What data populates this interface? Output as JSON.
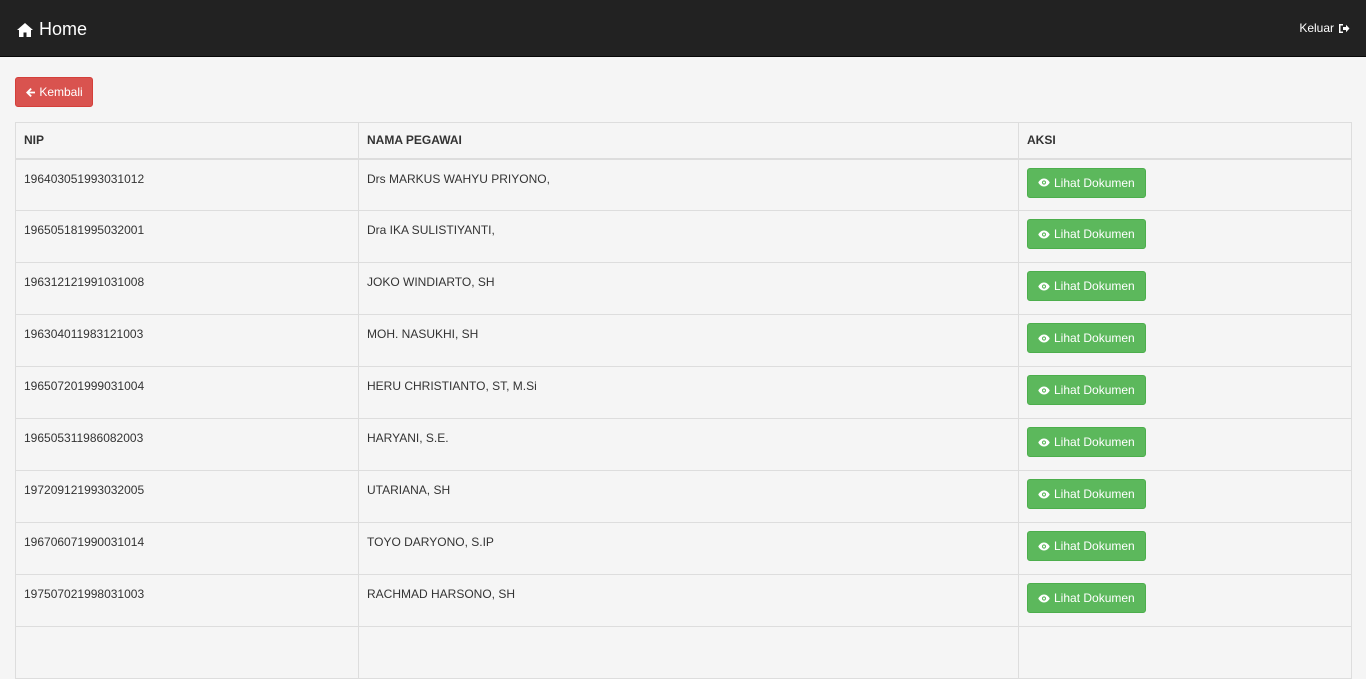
{
  "navbar": {
    "title": "Home",
    "title_icon": "home-icon",
    "logout_label": "Keluar",
    "logout_icon": "sign-out-icon"
  },
  "back_button": {
    "label": "Kembali",
    "icon": "arrow-left-icon"
  },
  "table": {
    "headers": [
      "NIP",
      "NAMA PEGAWAI",
      "AKSI"
    ],
    "action_label": "Lihat Dokumen",
    "action_icon": "eye-icon",
    "rows": [
      {
        "nip": "196403051993031012",
        "nama": "Drs MARKUS WAHYU PRIYONO,"
      },
      {
        "nip": "196505181995032001",
        "nama": "Dra IKA SULISTIYANTI,"
      },
      {
        "nip": "196312121991031008",
        "nama": "JOKO WINDIARTO, SH"
      },
      {
        "nip": "196304011983121003",
        "nama": "MOH. NASUKHI, SH"
      },
      {
        "nip": "196507201999031004",
        "nama": "HERU CHRISTIANTO, ST, M.Si"
      },
      {
        "nip": "196505311986082003",
        "nama": "HARYANI, S.E."
      },
      {
        "nip": "197209121993032005",
        "nama": "UTARIANA, SH"
      },
      {
        "nip": "196706071990031014",
        "nama": "TOYO DARYONO, S.IP"
      },
      {
        "nip": "197507021998031003",
        "nama": "RACHMAD HARSONO, SH"
      },
      {
        "nip": "",
        "nama": ""
      }
    ]
  },
  "colors": {
    "navbar_bg": "#222222",
    "danger": "#d9534f",
    "success": "#5cb85c",
    "page_bg": "#f5f5f5"
  }
}
